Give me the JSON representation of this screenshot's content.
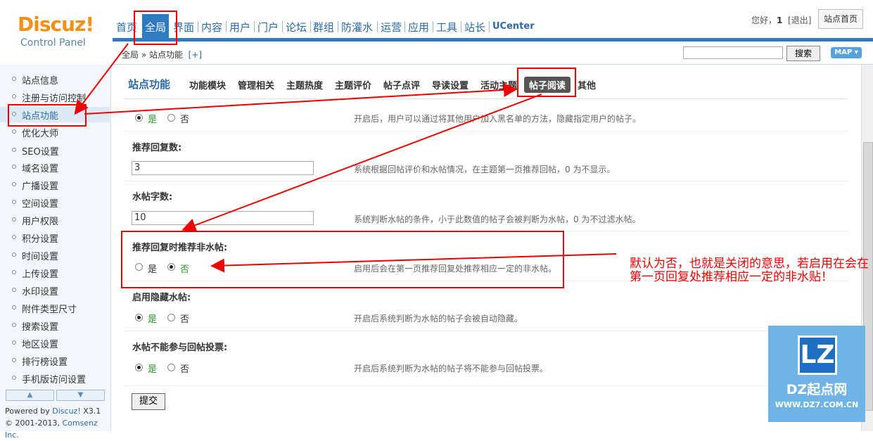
{
  "logo": {
    "brand": "Discuz!",
    "subtitle": "Control Panel"
  },
  "nav": [
    "首页",
    "全局",
    "界面",
    "内容",
    "用户",
    "门户",
    "论坛",
    "群组",
    "防灌水",
    "运营",
    "应用",
    "工具",
    "站长",
    "UCenter"
  ],
  "header": {
    "greeting_prefix": "您好，",
    "username": "1",
    "logout": "[退出]",
    "home_button": "站点首页"
  },
  "breadcrumb": {
    "path": "全局 » 站点功能",
    "add": "[+]"
  },
  "search": {
    "value": "",
    "button": "搜索",
    "map": "MAP ▾"
  },
  "sidebar": {
    "items": [
      "站点信息",
      "注册与访问控制",
      "站点功能",
      "优化大师",
      "SEO设置",
      "域名设置",
      "广播设置",
      "空间设置",
      "用户权限",
      "积分设置",
      "时间设置",
      "上传设置",
      "水印设置",
      "附件类型尺寸",
      "搜索设置",
      "地区设置",
      "排行榜设置",
      "手机版访问设置"
    ],
    "active_index": 2,
    "powered_line1": "Powered by ",
    "powered_link": "Discuz!",
    "powered_version": " X3.1",
    "copyright_prefix": "© 2001-2013, ",
    "copyright_link": "Comsenz Inc."
  },
  "main": {
    "title": "站点功能",
    "tabs": [
      "功能模块",
      "管理相关",
      "主题热度",
      "主题评价",
      "帖子点评",
      "导读设置",
      "活动主题",
      "帖子阅读",
      "其他"
    ],
    "active_tab": 7,
    "yes": "是",
    "no": "否",
    "rows": [
      {
        "label": "",
        "type": "radio",
        "value": "yes",
        "desc": "开启后，用户可以通过将其他用户加入黑名单的方法，隐藏指定用户的帖子。"
      },
      {
        "label": "推荐回复数:",
        "type": "text",
        "value": "3",
        "desc": "系统根据回帖评价和水帖情况，在主题第一页推荐回帖，0 为不显示。"
      },
      {
        "label": "水帖字数:",
        "type": "text",
        "value": "10",
        "desc": "系统判断水帖的条件，小于此数值的帖子会被判断为水帖，0 为不过滤水帖。"
      },
      {
        "label": "推荐回复时推荐非水帖:",
        "type": "radio",
        "value": "no",
        "desc": "启用后会在第一页推荐回复处推荐相应一定的非水帖。"
      },
      {
        "label": "启用隐藏水帖:",
        "type": "radio",
        "value": "yes",
        "desc": "开启后系统判断为水帖的帖子会被自动隐藏。"
      },
      {
        "label": "水帖不能参与回帖投票:",
        "type": "radio",
        "value": "yes",
        "desc": "开启后系统判断为水帖的帖子将不能参与回帖投票。"
      }
    ],
    "submit": "提交"
  },
  "annotation": "默认为否，也就是关闭的意思，若启用在会在第一页回复处推荐相应一定的非水贴！",
  "watermark": {
    "logo": "LZ",
    "title": "DZ起点网",
    "url": "WWW.DZ7.COM.CN"
  },
  "colors": {
    "accent": "#2f7ac0",
    "annotation": "#ee0000",
    "logo_orange": "#f29019"
  }
}
